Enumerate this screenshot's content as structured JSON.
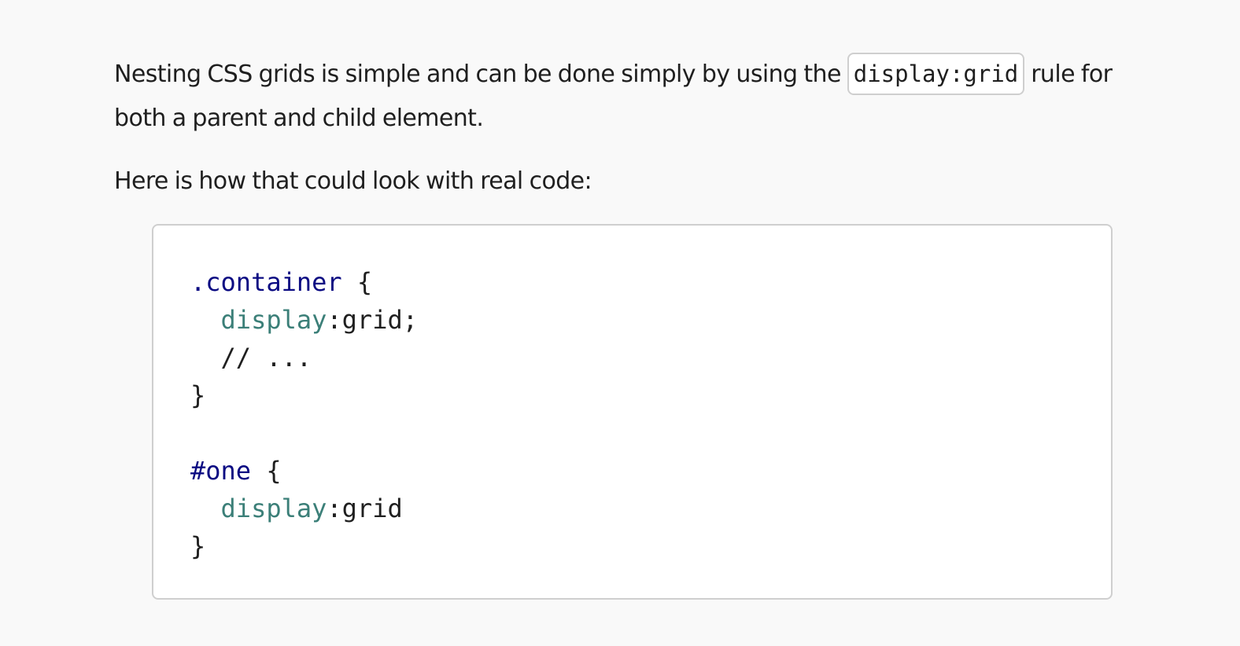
{
  "intro": {
    "before": "Nesting CSS grids is simple and can be done simply by using the ",
    "inline_code": "display:grid",
    "after": " rule for both a parent and child element."
  },
  "lead": "Here is how that could look with real code:",
  "code_block": {
    "lines": [
      [
        {
          "t": "selector",
          "v": ".container"
        },
        {
          "t": "plain",
          "v": " {"
        }
      ],
      [
        {
          "t": "plain",
          "v": "  "
        },
        {
          "t": "prop",
          "v": "display"
        },
        {
          "t": "plain",
          "v": ":grid;"
        }
      ],
      [
        {
          "t": "comment",
          "v": "  // ..."
        }
      ],
      [
        {
          "t": "plain",
          "v": "}"
        }
      ],
      [],
      [
        {
          "t": "selector",
          "v": "#one"
        },
        {
          "t": "plain",
          "v": " {"
        }
      ],
      [
        {
          "t": "plain",
          "v": "  "
        },
        {
          "t": "prop",
          "v": "display"
        },
        {
          "t": "plain",
          "v": ":grid"
        }
      ],
      [
        {
          "t": "plain",
          "v": "}"
        }
      ]
    ]
  }
}
